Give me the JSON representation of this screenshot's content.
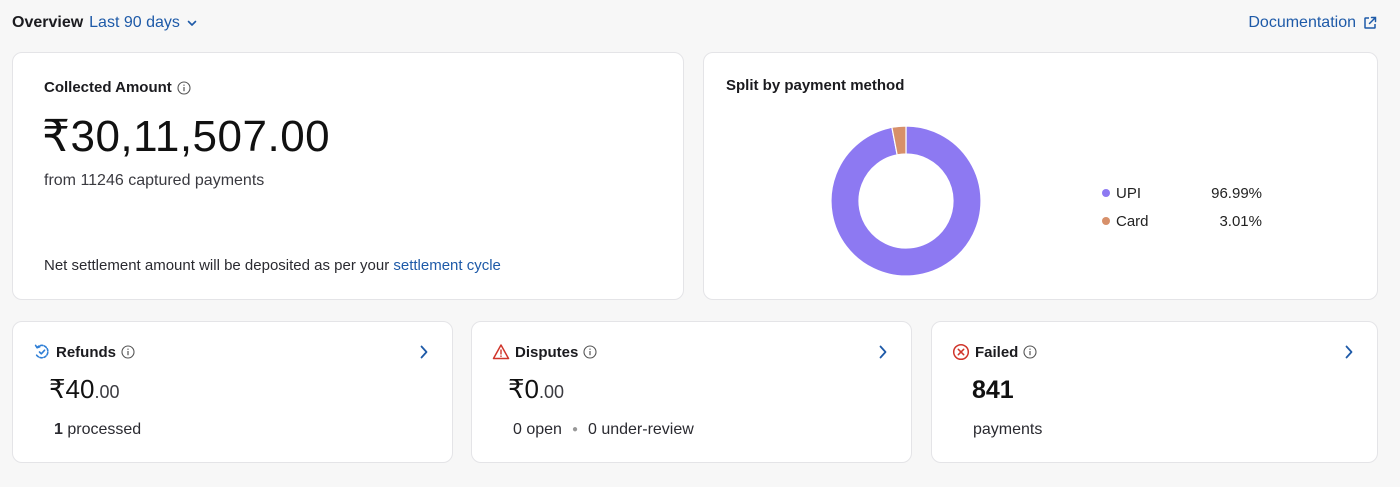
{
  "header": {
    "title": "Overview",
    "range_label": "Last 90 days",
    "doc_label": "Documentation"
  },
  "collected": {
    "title": "Collected Amount",
    "amount": "₹30,11,507.00",
    "subtitle": "from 11246 captured payments",
    "note_prefix": "Net settlement amount will be deposited as per your",
    "note_link": "settlement cycle"
  },
  "split": {
    "title": "Split by payment method",
    "chart_data": {
      "type": "pie",
      "donut": true,
      "categories": [
        "UPI",
        "Card"
      ],
      "values": [
        96.99,
        3.01
      ],
      "colors": [
        "#8d79f2",
        "#d7906a"
      ],
      "legend_placement": "right"
    },
    "legend": [
      {
        "label": "UPI",
        "value": "96.99%",
        "color": "#8d79f2"
      },
      {
        "label": "Card",
        "value": "3.01%",
        "color": "#d7906a"
      }
    ]
  },
  "refunds": {
    "title": "Refunds",
    "currency": "₹",
    "whole": "40",
    "cents": ".00",
    "count": "1",
    "count_label": "processed",
    "icon": "refund-icon"
  },
  "disputes": {
    "title": "Disputes",
    "currency": "₹",
    "whole": "0",
    "cents": ".00",
    "open": "0 open",
    "review": "0 under-review",
    "icon": "warning-icon"
  },
  "failed": {
    "title": "Failed",
    "count": "841",
    "label": "payments",
    "icon": "failed-icon"
  },
  "colors": {
    "accent": "#1e5aa8",
    "refund_icon": "#2f7fd6",
    "dispute_icon": "#d0352b",
    "failed_icon": "#d0352b"
  }
}
